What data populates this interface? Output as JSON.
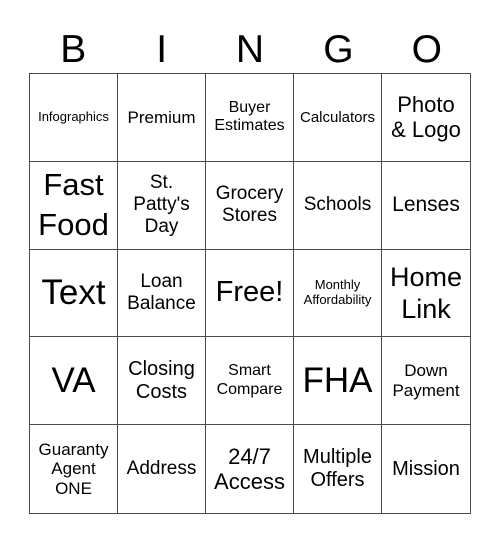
{
  "header": {
    "letters": [
      "B",
      "I",
      "N",
      "G",
      "O"
    ]
  },
  "cells": [
    [
      "Infographics",
      "Premium",
      "Buyer\nEstimates",
      "Calculators",
      "Photo\n& Logo"
    ],
    [
      "Fast\nFood",
      "St.\nPatty's\nDay",
      "Grocery\nStores",
      "Schools",
      "Lenses"
    ],
    [
      "Text",
      "Loan\nBalance",
      "Free!",
      "Monthly\nAffordability",
      "Home\nLink"
    ],
    [
      "VA",
      "Closing\nCosts",
      "Smart\nCompare",
      "FHA",
      "Down\nPayment"
    ],
    [
      "Guaranty\nAgent\nONE",
      "Address",
      "24/7\nAccess",
      "Multiple\nOffers",
      "Mission"
    ]
  ]
}
